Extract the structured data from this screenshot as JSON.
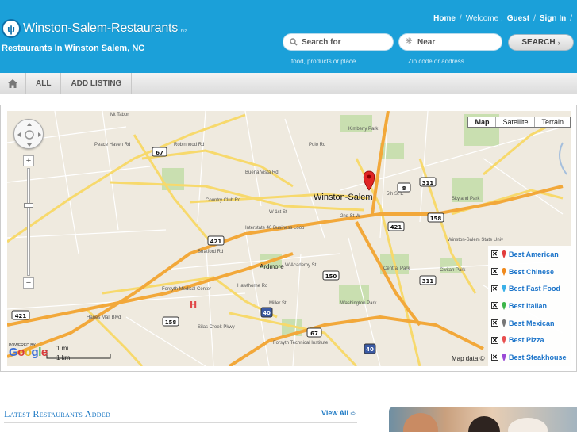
{
  "site": {
    "name": "Winston-Salem-Restaurants",
    "sup": ".biz",
    "tagline": "Restaurants In Winston Salem, NC"
  },
  "topnav": {
    "home": "Home",
    "welcome": "Welcome ,",
    "user": "Guest",
    "signin": "Sign In"
  },
  "search": {
    "for_placeholder": "Search for",
    "near_placeholder": "Near",
    "button": "SEARCH",
    "hint_for": "food, products or place",
    "hint_near": "Zip code or address"
  },
  "nav": {
    "items": [
      "ALL",
      "ADD LISTING"
    ]
  },
  "map": {
    "types": [
      "Map",
      "Satellite",
      "Terrain"
    ],
    "center_label": "Winston-Salem",
    "labels": [
      "Mt Tabor",
      "Robinhood Rd",
      "Buena Vista Rd",
      "Country Club Rd",
      "Interstate 40 Business Loop",
      "Ardmore",
      "W Academy St",
      "Hanes Mall Blvd",
      "Silas Creek Pkwy",
      "Forsyth Medical Center",
      "Forsyth Technical Institute",
      "Washington Park",
      "Central Park",
      "Skyland Park",
      "Kimberly Park",
      "Winston-Salem State Univ",
      "Civitan Park",
      "2nd St W",
      "5th St E",
      "W 1st St",
      "Peace Haven Rd",
      "Stratford Rd",
      "Hawthorne Rd",
      "Miller St",
      "Polo Rd"
    ],
    "shields": [
      "67",
      "421",
      "8",
      "311",
      "158",
      "150",
      "421",
      "311",
      "158",
      "40",
      "67",
      "40",
      "421"
    ],
    "scale_mi": "1 mi",
    "scale_km": "1 km",
    "powered": "POWERED BY",
    "google": "Google",
    "mapdata": "Map data ©"
  },
  "legend": [
    {
      "label": "Best American",
      "color": "#e23c3c"
    },
    {
      "label": "Best Chinese",
      "color": "#f08a1c"
    },
    {
      "label": "Best Fast Food",
      "color": "#3bb0e8"
    },
    {
      "label": "Best Italian",
      "color": "#3cb64a"
    },
    {
      "label": "Best Mexican",
      "color": "#777777"
    },
    {
      "label": "Best Pizza",
      "color": "#e84f4f"
    },
    {
      "label": "Best Steakhouse",
      "color": "#9a4ad6"
    }
  ],
  "latest": {
    "title": "Latest Restaurants Added",
    "view_all": "View All"
  },
  "colors": {
    "header": "#1ba0d9",
    "link": "#1b78c4"
  }
}
